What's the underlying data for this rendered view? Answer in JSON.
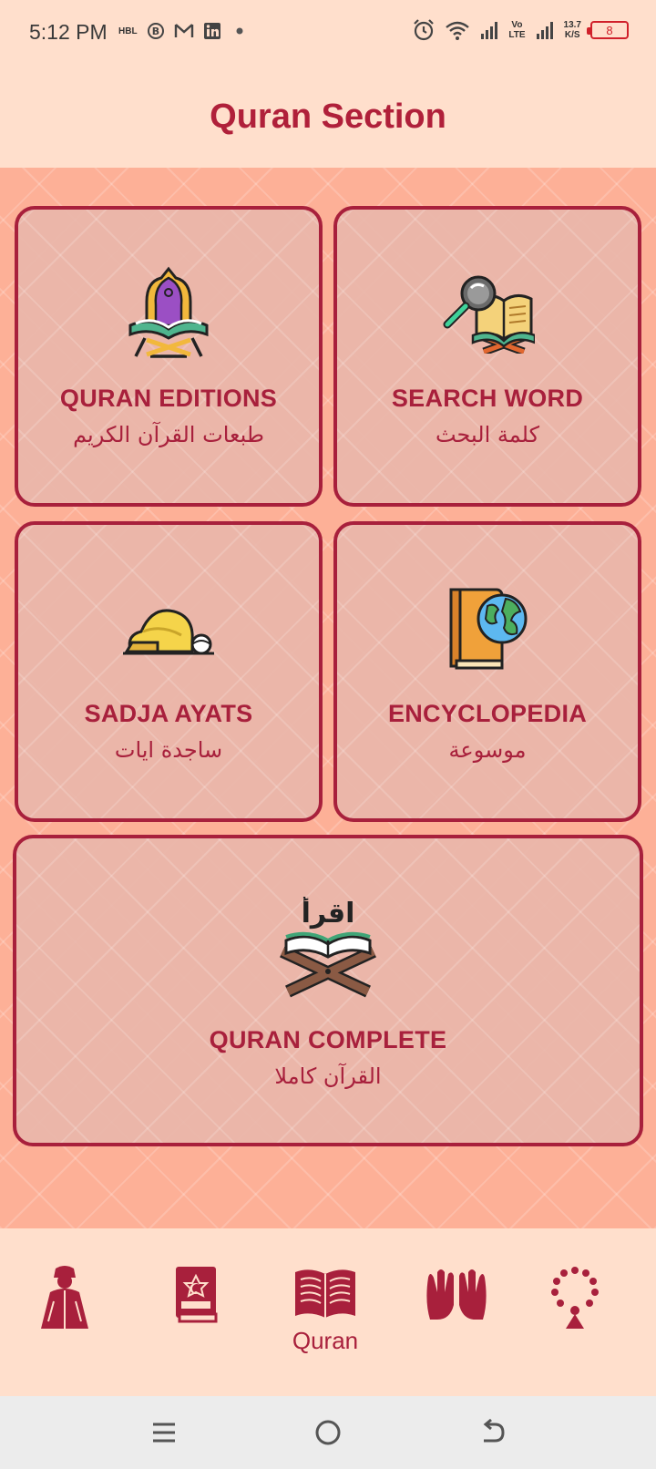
{
  "status_bar": {
    "time": "5:12 PM",
    "left_icons": [
      "hbl-icon",
      "b-icon",
      "gmail-icon",
      "linkedin-icon",
      "dot-icon"
    ],
    "carrier_label": "HBL",
    "volte_label_top": "Vo",
    "volte_label_bottom": "LTE",
    "speed_value": "13.7",
    "speed_unit": "K/S",
    "battery": "8"
  },
  "header": {
    "title": "Quran Section"
  },
  "cards": {
    "editions": {
      "title": "QURAN EDITIONS",
      "subtitle": "طبعات القرآن الكريم",
      "icon": "quran-stand-icon"
    },
    "search": {
      "title": "SEARCH WORD",
      "subtitle": "كلمة البحث",
      "icon": "magnifier-book-icon"
    },
    "sadja": {
      "title": "SADJA AYATS",
      "subtitle": "ساجدة ايات",
      "icon": "prostration-icon"
    },
    "encyclopedia": {
      "title": "ENCYCLOPEDIA",
      "subtitle": "موسوعة",
      "icon": "globe-book-icon"
    },
    "complete": {
      "title": "QURAN COMPLETE",
      "subtitle": "القرآن كاملا",
      "icon": "iqra-quran-icon",
      "icon_text": "اقرأ"
    }
  },
  "bottom_nav": {
    "items": [
      {
        "icon": "hajj-person-icon",
        "label": ""
      },
      {
        "icon": "prayer-book-icon",
        "label": ""
      },
      {
        "icon": "open-quran-icon",
        "label": "Quran",
        "active": true
      },
      {
        "icon": "dua-hands-icon",
        "label": ""
      },
      {
        "icon": "tasbih-icon",
        "label": ""
      }
    ]
  },
  "colors": {
    "accent": "#a8203c",
    "background": "#ffdfcc",
    "pattern": "#fdb097"
  }
}
